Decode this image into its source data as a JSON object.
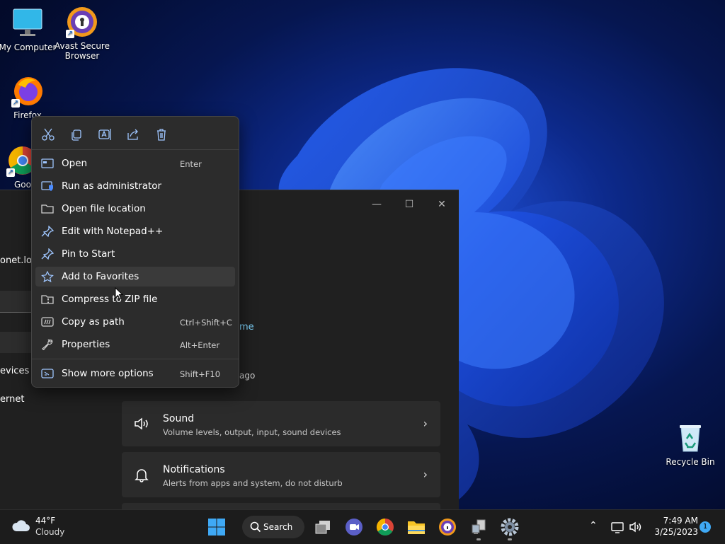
{
  "desktop": {
    "icons": [
      {
        "label": "My Computer"
      },
      {
        "label": "Avast Secure Browser"
      },
      {
        "label": "Firefox"
      },
      {
        "label": "Goo"
      },
      {
        "label": "Recycle Bin"
      }
    ]
  },
  "settings": {
    "left_fragments": [
      "onet.loca",
      "evices",
      "ernet"
    ],
    "fragment_home": "me",
    "fragment_ago": "ago",
    "cards": [
      {
        "title": "Sound",
        "subtitle": "Volume levels, output, input, sound devices"
      },
      {
        "title": "Notifications",
        "subtitle": "Alerts from apps and system, do not disturb"
      }
    ]
  },
  "context_menu": {
    "toolbar": [
      "cut-icon",
      "copy-icon",
      "rename-icon",
      "share-icon",
      "delete-icon"
    ],
    "items": [
      {
        "label": "Open",
        "shortcut": "Enter",
        "icon": "open-app-icon"
      },
      {
        "label": "Run as administrator",
        "shortcut": "",
        "icon": "shield-icon"
      },
      {
        "label": "Open file location",
        "shortcut": "",
        "icon": "folder-icon"
      },
      {
        "label": "Edit with Notepad++",
        "shortcut": "",
        "icon": "pin-icon"
      },
      {
        "label": "Pin to Start",
        "shortcut": "",
        "icon": "pin-icon"
      },
      {
        "label": "Add to Favorites",
        "shortcut": "",
        "icon": "star-icon"
      },
      {
        "label": "Compress to ZIP file",
        "shortcut": "",
        "icon": "zip-icon"
      },
      {
        "label": "Copy as path",
        "shortcut": "Ctrl+Shift+C",
        "icon": "path-icon"
      },
      {
        "label": "Properties",
        "shortcut": "Alt+Enter",
        "icon": "wrench-icon"
      },
      {
        "label": "Show more options",
        "shortcut": "Shift+F10",
        "icon": "more-options-icon"
      }
    ]
  },
  "taskbar": {
    "weather": {
      "temp": "44°F",
      "condition": "Cloudy"
    },
    "search_label": "Search",
    "time": "7:49 AM",
    "date": "3/25/2023",
    "notification_count": "1"
  }
}
